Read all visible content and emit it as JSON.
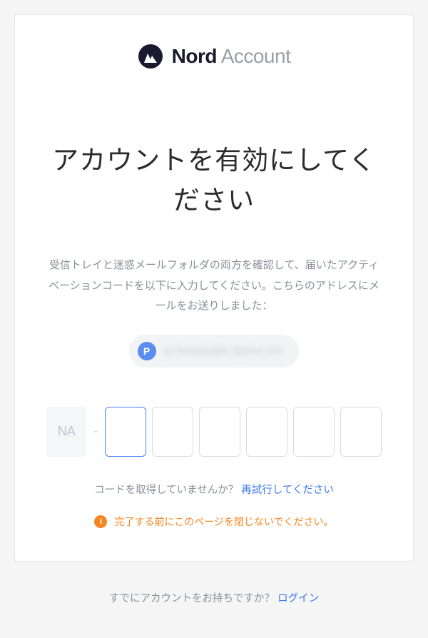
{
  "logo": {
    "nord": "Nord",
    "account": "Account"
  },
  "title": "アカウントを有効にしてください",
  "instructions": "受信トレイと迷惑メールフォルダの両方を確認して、届いたアクティベーションコードを以下に入力してください。こちらのアドレスにメールをお送りしました：",
  "email": {
    "avatar_letter": "P",
    "address_obscured": "pr.kotaka@b-space.net"
  },
  "code": {
    "prefix": "NA",
    "dash": "-",
    "digits": [
      "",
      "",
      "",
      "",
      "",
      ""
    ]
  },
  "retry": {
    "prompt": "コードを取得していませんか？",
    "link": "再試行してください"
  },
  "warning": {
    "icon_letter": "i",
    "text": "完了する前にこのページを閉じないでください。"
  },
  "footer": {
    "prompt": "すでにアカウントをお持ちですか？",
    "link": "ログイン"
  }
}
